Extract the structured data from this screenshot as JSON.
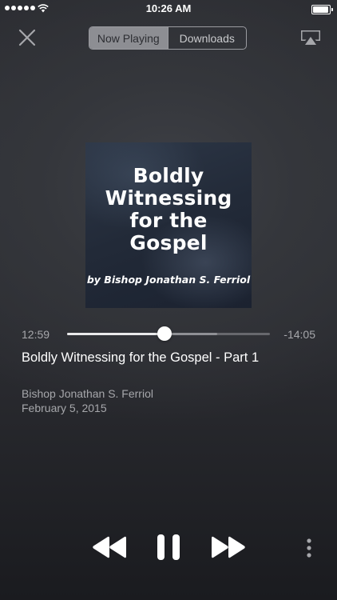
{
  "status_bar": {
    "time": "10:26 AM"
  },
  "top_bar": {
    "segments": [
      "Now Playing",
      "Downloads"
    ],
    "selected_segment": "Now Playing"
  },
  "artwork": {
    "title": "Boldly\nWitnessing\nfor the\nGospel",
    "author": "by Bishop Jonathan S. Ferriol",
    "background_color": "#222a38"
  },
  "player": {
    "elapsed": "12:59",
    "remaining": "-14:05",
    "progress_fraction": 0.48,
    "buffered_fraction": 0.74,
    "title": "Boldly Witnessing for the Gospel - Part 1",
    "artist": "Bishop Jonathan S. Ferriol",
    "date": "February 5, 2015"
  },
  "icons": {
    "close": "close-icon",
    "airplay": "airplay-icon",
    "rewind": "rewind-icon",
    "pause": "pause-icon",
    "forward": "fast-forward-icon",
    "more": "more-vertical-icon"
  },
  "colors": {
    "background": "#2e3035",
    "accent_text": "#ffffff",
    "secondary_text": "#a6a7ab",
    "segment_active": "#8d8e93"
  }
}
